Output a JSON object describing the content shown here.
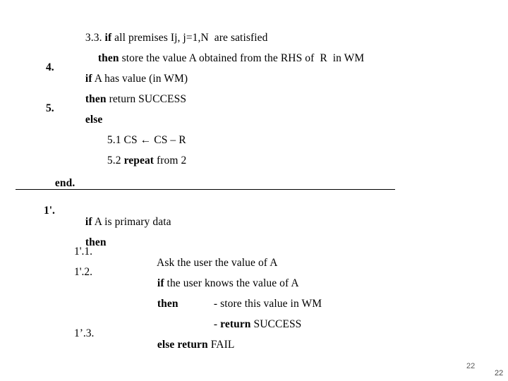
{
  "slide": {
    "page_number_primary": "22",
    "page_number_secondary": "22",
    "divider": "horizontal-rule"
  },
  "algorithm_top": {
    "lines": [
      {
        "label": "",
        "segments": [
          {
            "text": "3.3. ",
            "bold": false
          },
          {
            "text": "if",
            "bold": true
          },
          {
            "text": " all premises Ij, j=1,N  are satisfied",
            "bold": false
          }
        ]
      },
      {
        "label": "",
        "segments": [
          {
            "text": "then",
            "bold": true
          },
          {
            "text": " store the value A obtained from the RHS of  R  in WM",
            "bold": false
          }
        ]
      },
      {
        "label": "4.",
        "segments": [
          {
            "text": "if",
            "bold": true
          },
          {
            "text": " A has value (in WM)",
            "bold": false
          }
        ]
      },
      {
        "label": "",
        "segments": [
          {
            "text": "then",
            "bold": true
          },
          {
            "text": " return SUCCESS",
            "bold": false
          }
        ]
      },
      {
        "label": "5.",
        "segments": [
          {
            "text": "else",
            "bold": true
          }
        ]
      },
      {
        "label": "",
        "segments": [
          {
            "text": "5.1 CS ← CS – R",
            "bold": false
          }
        ]
      },
      {
        "label": "",
        "segments": [
          {
            "text": "5.2 ",
            "bold": false
          },
          {
            "text": "repeat",
            "bold": true
          },
          {
            "text": " from 2",
            "bold": false
          }
        ]
      },
      {
        "label": "",
        "segments": [
          {
            "text": "end.",
            "bold": true
          }
        ]
      }
    ],
    "text_l1": "3.3. ",
    "text_l1_kw": "if",
    "text_l1_rest": " all premises Ij, j=1,N  are satisfied",
    "text_l2_kw": "then",
    "text_l2_rest": " store the value A obtained from the RHS of  R  in WM",
    "label_4": "4.",
    "text_l3_kw": "if",
    "text_l3_rest": " A has value (in WM)",
    "text_l4_kw": "then",
    "text_l4_rest": " return SUCCESS",
    "label_5": "5.",
    "text_l5_kw": "else",
    "text_l6": "5.1 CS ← CS – R",
    "text_l7_num": "5.2 ",
    "text_l7_kw": "repeat",
    "text_l7_rest": " from 2",
    "text_end": "end."
  },
  "algorithm_bottom": {
    "label_1prime": "1'.",
    "text_b1_kw": "if",
    "text_b1_rest": " A is primary data",
    "text_b2_kw": "then",
    "label_b3": "1'.1.",
    "text_b3": "Ask the user the value of A",
    "label_b4": "1'.2.",
    "text_b4_kw": "if",
    "text_b4_rest": " the user knows the value of A",
    "text_b5_kw": "then",
    "text_b5_rest": "- store this value in WM",
    "text_b6_dash": "- ",
    "text_b6_kw": "return",
    "text_b6_rest": " SUCCESS",
    "label_b7": "1’.3.",
    "text_b7_kw": "else return",
    "text_b7_rest": " FAIL"
  }
}
